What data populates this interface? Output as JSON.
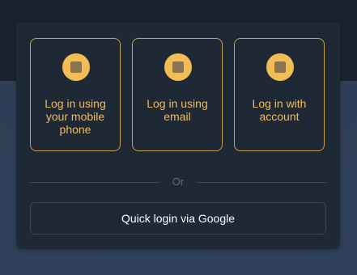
{
  "login_options": [
    {
      "label": "Log in using your mobile phone",
      "icon": "mobile-phone-icon"
    },
    {
      "label": "Log in using email",
      "icon": "email-icon"
    },
    {
      "label": "Log in with account",
      "icon": "account-icon"
    }
  ],
  "divider": {
    "text": "Or"
  },
  "google_button": {
    "label": "Quick login via Google"
  },
  "colors": {
    "accent": "#f0bd5a",
    "border_accent": "#caa24f",
    "card_bg": "#1f2835",
    "page_top": "#1a2230",
    "page_bottom": "#2d3e55"
  }
}
